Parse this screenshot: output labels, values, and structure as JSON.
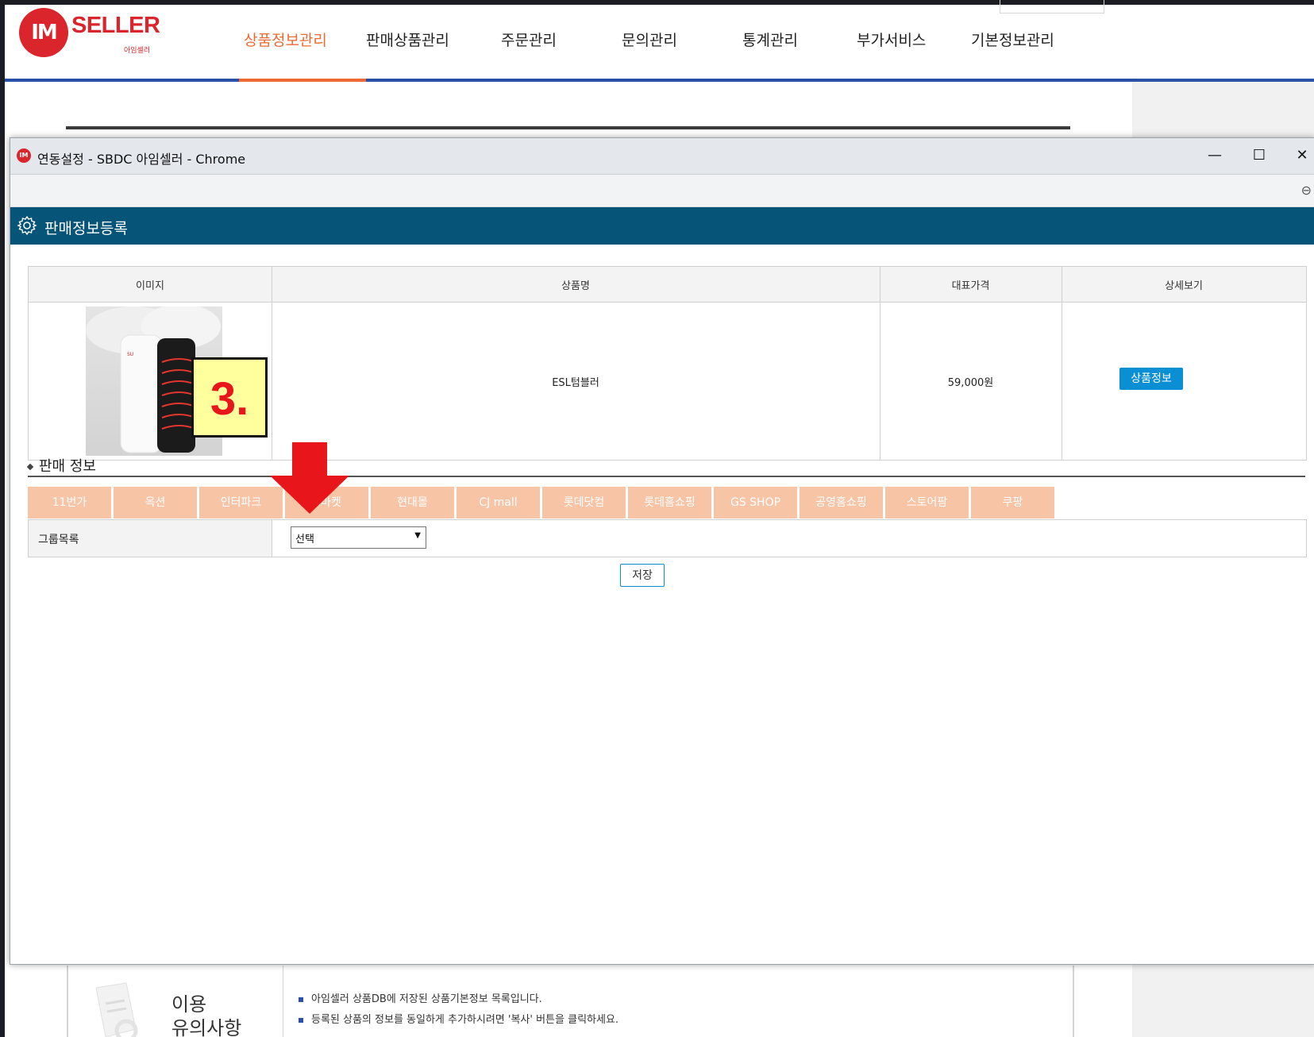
{
  "site": {
    "logo_text": "SELLER",
    "logo_sub": "아임셀러",
    "logo_mark": "IM",
    "nav": [
      "상품정보관리",
      "판매상품관리",
      "주문관리",
      "문의관리",
      "통계관리",
      "부가서비스",
      "기본정보관리"
    ],
    "active_nav": "상품정보관리",
    "notice": {
      "title_line1": "이용",
      "title_line2": "유의사항",
      "lines": [
        "아임셀러 상품DB에 저장된 상품기본정보 목록입니다.",
        "등록된 상품의 정보를 동일하게 추가하시려면 '복사' 버튼을 클릭하세요."
      ]
    }
  },
  "popup": {
    "window_title": "연동설정 - SBDC 아임셀러 - Chrome",
    "controls": {
      "minimize": "—",
      "maximize": "☐",
      "close": "✕"
    },
    "section_title": "판매정보등록",
    "product_table": {
      "headers": [
        "이미지",
        "상품명",
        "대표가격",
        "상세보기"
      ],
      "row": {
        "name": "ESL텀블러",
        "price": "59,000원",
        "detail_button": "상품정보"
      }
    },
    "step_badge": "3.",
    "sales_info_title": "판매 정보",
    "marketplace_tabs": [
      "11번가",
      "옥션",
      "인터파크",
      "G마켓",
      "현대몰",
      "CJ mall",
      "롯데닷컴",
      "롯데홈쇼핑",
      "GS SHOP",
      "공영홈쇼핑",
      "스토어팜",
      "쿠팡"
    ],
    "group_label": "그룹목록",
    "group_select_value": "선택",
    "save_button": "저장"
  },
  "colors": {
    "brand_red": "#d9252b",
    "active_orange": "#ee6a35",
    "header_navy": "#065478",
    "tab_peach": "#f7c4a5",
    "button_blue": "#0b8fd4",
    "annotation_red": "#e8161b"
  },
  "icons": [
    "settings-gear-icon",
    "zoom-icon",
    "dropdown-arrow-icon",
    "red-arrow-annotation",
    "notice-document-icon"
  ]
}
